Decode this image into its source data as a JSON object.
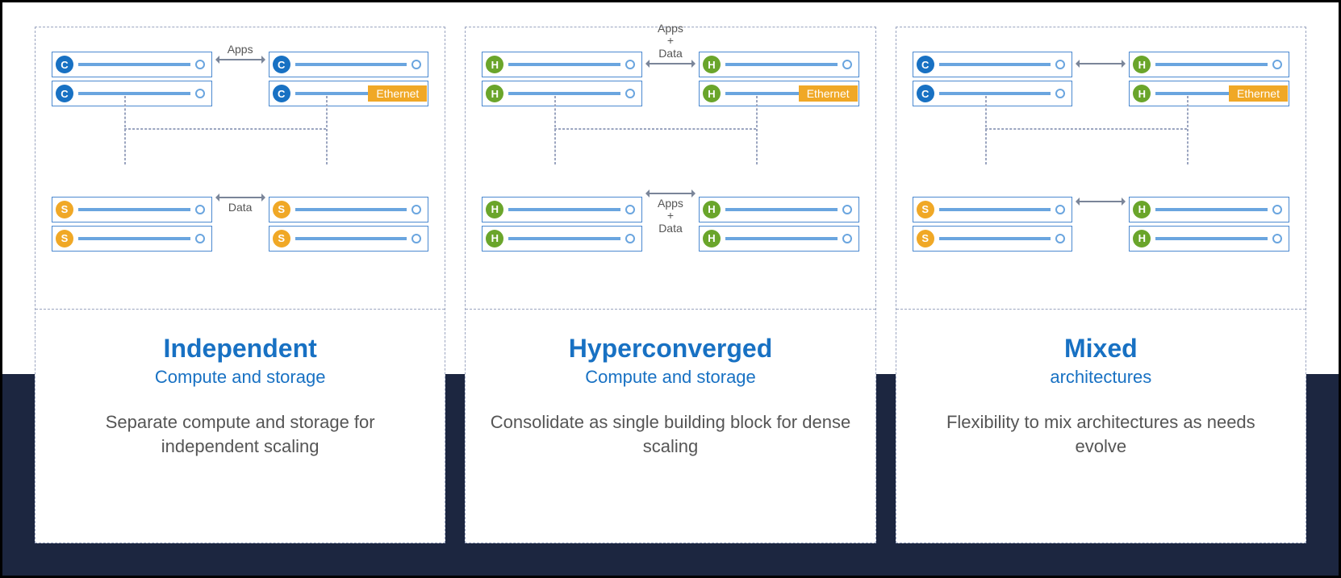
{
  "panels": [
    {
      "title": "Independent",
      "subtitle": "Compute and storage",
      "description": "Separate compute and storage for independent scaling",
      "top_label": "Apps",
      "bottom_label": "Data",
      "ethernet": "Ethernet",
      "nodes": {
        "top_left": [
          "C",
          "C"
        ],
        "top_right": [
          "C",
          "C"
        ],
        "bot_left": [
          "S",
          "S"
        ],
        "bot_right": [
          "S",
          "S"
        ]
      }
    },
    {
      "title": "Hyperconverged",
      "subtitle": "Compute and storage",
      "description": "Consolidate as single building block for dense scaling",
      "top_label": "Apps\n+\nData",
      "bottom_label": "Apps\n+\nData",
      "ethernet": "Ethernet",
      "nodes": {
        "top_left": [
          "H",
          "H"
        ],
        "top_right": [
          "H",
          "H"
        ],
        "bot_left": [
          "H",
          "H"
        ],
        "bot_right": [
          "H",
          "H"
        ]
      }
    },
    {
      "title": "Mixed",
      "subtitle": "architectures",
      "description": "Flexibility to mix architectures as needs evolve",
      "top_label": "",
      "bottom_label": "",
      "ethernet": "Ethernet",
      "nodes": {
        "top_left": [
          "C",
          "C"
        ],
        "top_right": [
          "H",
          "H"
        ],
        "bot_left": [
          "S",
          "S"
        ],
        "bot_right": [
          "H",
          "H"
        ]
      }
    }
  ]
}
